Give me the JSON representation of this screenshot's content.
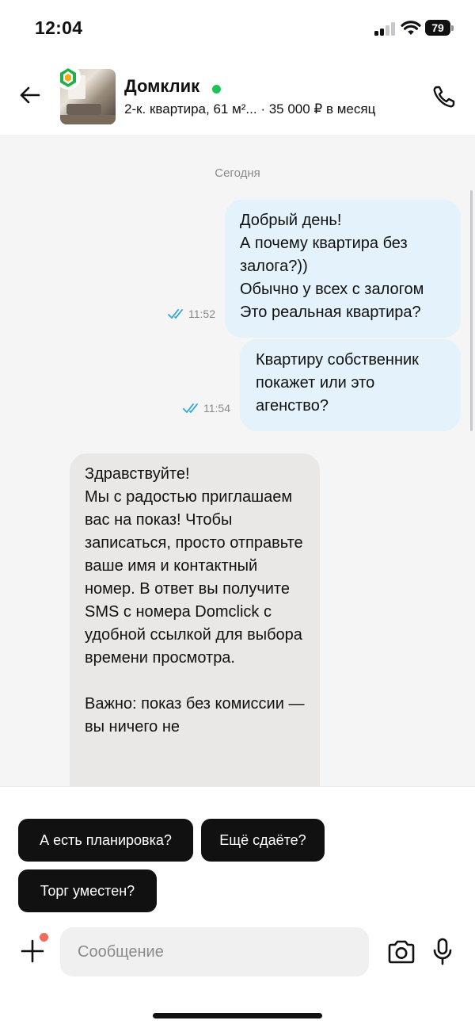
{
  "status_bar": {
    "time": "12:04",
    "battery": "79",
    "icons": [
      "signal-icon",
      "wifi-icon",
      "battery-icon"
    ]
  },
  "header": {
    "title": "Домклик",
    "online": true,
    "online_color": "#21c15a",
    "subtitle": "2-к. квартира, 61 м²...  · 35 000 ₽ в месяц",
    "icons": [
      "back-arrow-icon",
      "domclick-logo-icon",
      "phone-icon"
    ]
  },
  "chat": {
    "date_separator": "Сегодня",
    "messages": [
      {
        "direction": "outgoing",
        "text": "Добрый день!\nА почему квартира без залога?))\nОбычно у всех с залогом\nЭто реальная квартира?",
        "time": "11:52",
        "read": true
      },
      {
        "direction": "outgoing",
        "text": "Квартиру собственник покажет или это агенство?",
        "time": "11:54",
        "read": true
      },
      {
        "direction": "incoming",
        "text": "Здравствуйте!\nМы с радостью приглашаем вас на показ! Чтобы записаться, просто отправьте ваше имя и контактный номер. В ответ вы получите SMS с номера Domclick с удобной ссылкой для выбора времени просмотра.\n\nВажно: показ без комиссии — вы ничего не"
      }
    ]
  },
  "quick_replies": [
    "А есть планировка?",
    "Ещё сдаёте?",
    "Торг уместен?"
  ],
  "composer": {
    "placeholder": "Сообщение",
    "value": "",
    "icons": [
      "plus-icon",
      "camera-icon",
      "microphone-icon"
    ],
    "attach_badge_color": "#f26a5a"
  },
  "colors": {
    "outgoing_bubble": "#e3f2fb",
    "incoming_bubble": "#e9e8e6",
    "read_ticks": "#2aa6e0",
    "chip_bg": "#111111"
  }
}
